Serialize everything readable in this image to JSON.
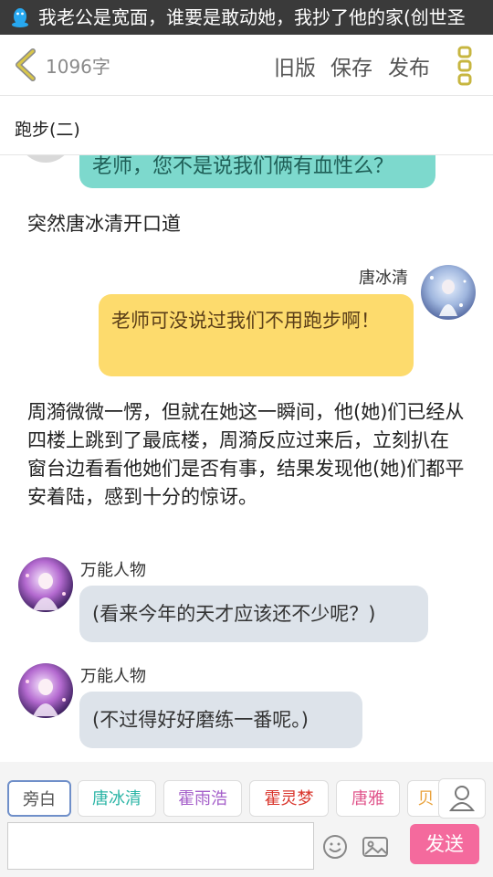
{
  "status_bar": {
    "notification_text": "我老公是宽面，谁要是敢动她，我抄了他的家(创世圣"
  },
  "toolbar": {
    "word_count": "1096字",
    "old_version_label": "旧版",
    "save_label": "保存",
    "publish_label": "发布"
  },
  "chapter": {
    "title": "跑步(二)"
  },
  "messages": {
    "top_bubble": "老师，您不是说我们俩有血性么？",
    "narration_1": "突然唐冰清开口道",
    "tang_name": "唐冰清",
    "tang_bubble": "老师可没说过我们不用跑步啊！",
    "narration_2": "周漪微微一愣，但就在她这一瞬间，他(她)们已经从四楼上跳到了最底楼，周漪反应过来后，立刻扒在窗台边看看他她们是否有事，结果发现他(她)们都平安着陆，感到十分的惊讶。",
    "wanneng_name_1": "万能人物",
    "wanneng_bubble_1": "(看来今年的天才应该还不少呢？)",
    "wanneng_name_2": "万能人物",
    "wanneng_bubble_2": "(不过得好好磨练一番呢。)"
  },
  "characters": [
    {
      "label": "旁白",
      "color": "#555555",
      "selected": true
    },
    {
      "label": "唐冰清",
      "color": "#2cb5a6"
    },
    {
      "label": "霍雨浩",
      "color": "#a45ec9"
    },
    {
      "label": "霍灵梦",
      "color": "#d9342b"
    },
    {
      "label": "唐雅",
      "color": "#e0558b"
    },
    {
      "label": "贝",
      "color": "#e9a13a"
    }
  ],
  "composer": {
    "input_value": "",
    "send_label": "发送"
  },
  "colors": {
    "teal_bubble": "#7dd9cd",
    "yellow_bubble": "#fddb6d",
    "gray_bubble": "#dde3ea",
    "send_button": "#f46a9d",
    "back_arrow": "#d8c64a"
  },
  "icons": [
    "qq-icon",
    "back-arrow-icon",
    "more-icon",
    "user-icon",
    "emoji-icon",
    "image-icon"
  ]
}
